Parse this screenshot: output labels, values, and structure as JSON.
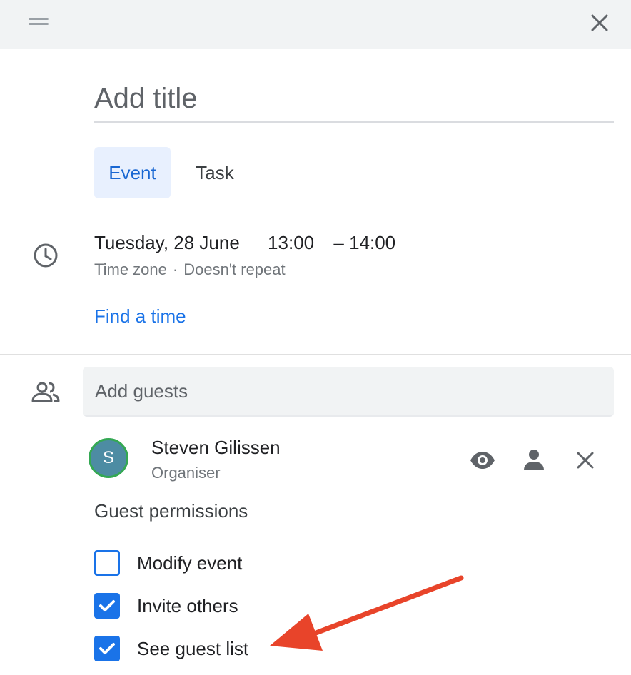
{
  "header": {
    "drag_icon": "drag-handle-icon",
    "close_icon": "close-icon"
  },
  "title": {
    "placeholder": "Add title",
    "value": ""
  },
  "tabs": [
    {
      "label": "Event",
      "selected": true
    },
    {
      "label": "Task",
      "selected": false
    }
  ],
  "when": {
    "icon": "clock-icon",
    "date": "Tuesday, 28 June",
    "start": "13:00",
    "dash": "–",
    "end": "14:00",
    "timezone": "Time zone",
    "separator": "·",
    "repeat": "Doesn't repeat",
    "find_time": "Find a time"
  },
  "guests": {
    "icon": "people-icon",
    "placeholder": "Add guests",
    "list": [
      {
        "initial": "S",
        "name": "Steven Gilissen",
        "role": "Organiser",
        "actions": [
          "eye-icon",
          "person-icon",
          "close-icon"
        ]
      }
    ]
  },
  "permissions": {
    "title": "Guest permissions",
    "items": [
      {
        "label": "Modify event",
        "checked": false
      },
      {
        "label": "Invite others",
        "checked": true
      },
      {
        "label": "See guest list",
        "checked": true
      }
    ]
  },
  "colors": {
    "accent": "#1a73e8",
    "tab_selected_bg": "#e8f0fe",
    "header_bg": "#f1f3f4",
    "avatar_bg": "#4d8ca3",
    "avatar_ring": "#34a853",
    "annotation_arrow": "#e8442a"
  }
}
